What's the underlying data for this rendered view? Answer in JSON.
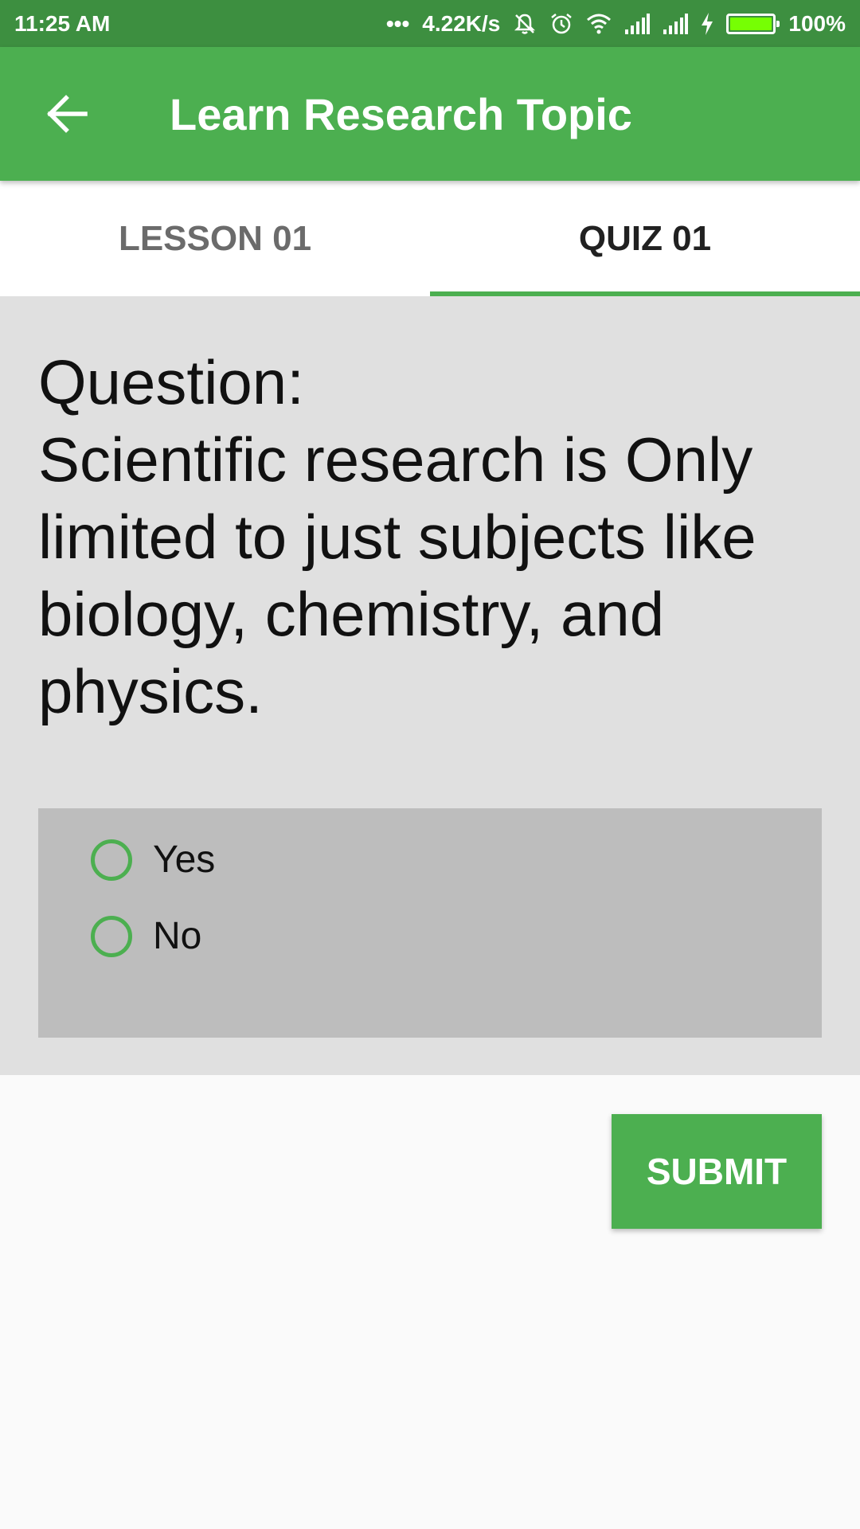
{
  "status_bar": {
    "time": "11:25 AM",
    "dots": "•••",
    "network_speed": "4.22K/s",
    "battery_percent": "100%",
    "battery_level": 1.0,
    "icons": [
      "silent-icon",
      "alarm-icon",
      "wifi-icon",
      "signal-icon",
      "signal-icon",
      "charging-icon",
      "battery-icon"
    ]
  },
  "app_bar": {
    "title": "Learn Research Topic",
    "back_icon": "arrow-back-icon",
    "color": "#4caf50"
  },
  "tabs": [
    {
      "label": "LESSON 01",
      "active": false
    },
    {
      "label": "QUIZ 01",
      "active": true
    }
  ],
  "quiz": {
    "question_label": "Question:",
    "question_text": "Scientific research is Only limited to just subjects like biology, chemistry, and physics.",
    "options": [
      {
        "label": "Yes",
        "selected": false
      },
      {
        "label": "No",
        "selected": false
      }
    ]
  },
  "submit_label": "SUBMIT",
  "colors": {
    "accent": "#4caf50",
    "status_bar": "#3d8f40",
    "panel": "#e0e0e0",
    "options_background": "#bdbdbd"
  }
}
